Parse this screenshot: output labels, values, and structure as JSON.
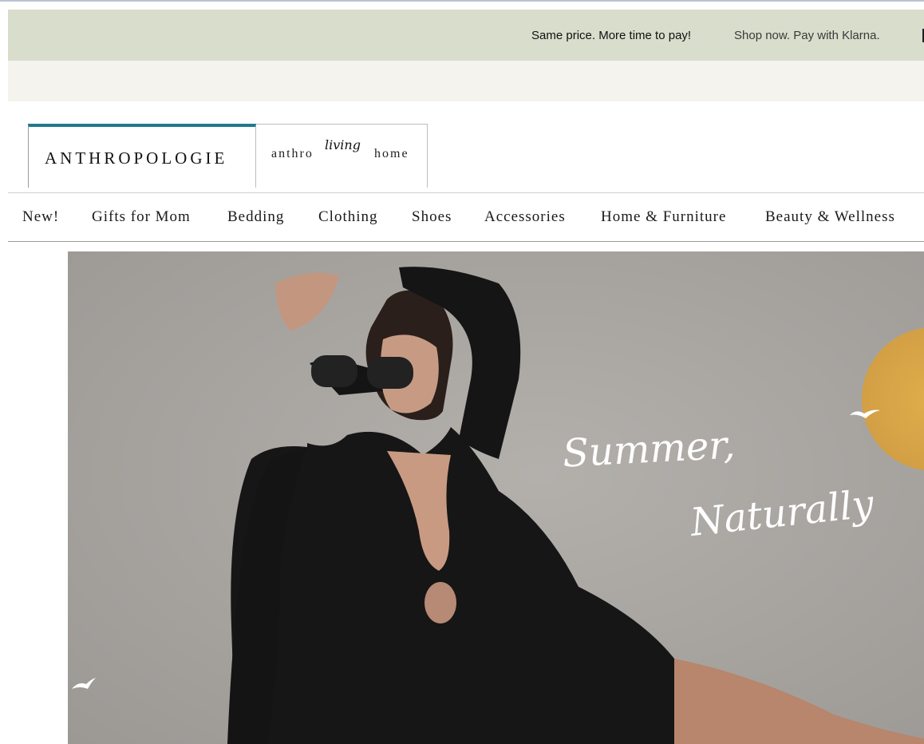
{
  "promo": {
    "message_primary": "Same price. More time to pay!",
    "message_secondary": "Shop now. Pay with Klarna."
  },
  "brand_tabs": {
    "anthropologie": "ANTHROPOLOGIE",
    "living": {
      "left": "anthro",
      "script": "living",
      "right": "home"
    }
  },
  "nav": {
    "items": [
      {
        "label": "New!"
      },
      {
        "label": "Gifts for Mom"
      },
      {
        "label": "Bedding"
      },
      {
        "label": "Clothing"
      },
      {
        "label": "Shoes"
      },
      {
        "label": "Accessories"
      },
      {
        "label": "Home & Furniture"
      },
      {
        "label": "Beauty & Wellness"
      }
    ]
  },
  "hero": {
    "headline_line1": "Summer,",
    "headline_line2": "Naturally"
  },
  "colors": {
    "promo_bg": "#d8ddcc",
    "subbar_bg": "#f4f3ee",
    "active_tab_accent": "#1f7a8c",
    "hero_bg": "#a8a5a1",
    "sun": "#d9a84a"
  },
  "icons": {
    "hero_birds": "bird-icon"
  }
}
